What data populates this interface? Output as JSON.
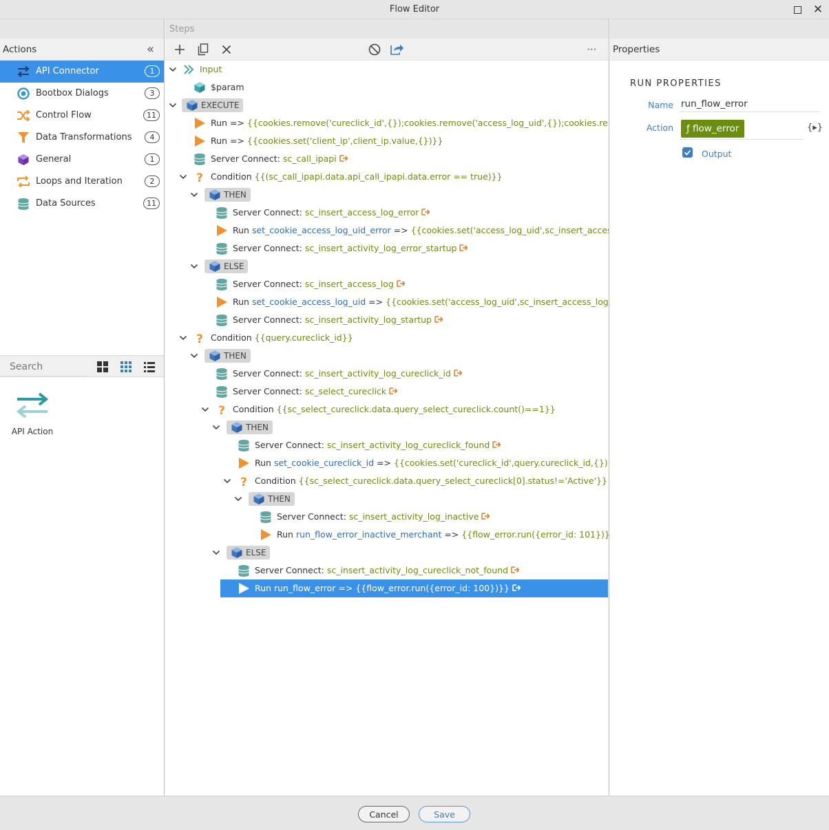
{
  "window": {
    "title": "Flow Editor"
  },
  "actions_panel": {
    "title": "Actions",
    "categories": [
      {
        "label": "API Connector",
        "count": "1",
        "icon": "api-arrows-icon"
      },
      {
        "label": "Bootbox Dialogs",
        "count": "3",
        "icon": "bootbox-icon"
      },
      {
        "label": "Control Flow",
        "count": "11",
        "icon": "shuffle-icon"
      },
      {
        "label": "Data Transformations",
        "count": "4",
        "icon": "funnel-icon"
      },
      {
        "label": "General",
        "count": "1",
        "icon": "cube-icon"
      },
      {
        "label": "Loops and Iteration",
        "count": "2",
        "icon": "loop-icon"
      },
      {
        "label": "Data Sources",
        "count": "11",
        "icon": "database-icon"
      }
    ],
    "search_placeholder": "Search",
    "palette": [
      {
        "label": "API Action",
        "icon": "api-action-icon"
      }
    ]
  },
  "steps_panel": {
    "title": "Steps",
    "rows": [
      {
        "kw": "Input"
      },
      {
        "kw": "$param"
      },
      {
        "kw": "EXECUTE"
      },
      {
        "kw": "Run",
        "op": " => ",
        "ex": "{{cookies.remove('cureclick_id',{});cookies.remove('access_log_uid',{});cookies.remove('client_ip',{})}}"
      },
      {
        "kw": "Run",
        "op": " => ",
        "ex": "{{cookies.set('client_ip',client_ip.value,{})}}"
      },
      {
        "kw": "Server Connect: ",
        "nm": "sc_call_ipapi"
      },
      {
        "kw": "Condition ",
        "ex": "{{(sc_call_ipapi.data.api_call_ipapi.data.error == true)}}"
      },
      {
        "kw": "THEN"
      },
      {
        "kw": "Server Connect: ",
        "nm": "sc_insert_access_log_error"
      },
      {
        "kw": "Run ",
        "nm": "set_cookie_access_log_uid_error",
        "op": " => ",
        "ex": "{{cookies.set('access_log_uid',sc_insert_access_log_error.data.insert_access_log.identity,{})}}"
      },
      {
        "kw": "Server Connect: ",
        "nm": "sc_insert_activity_log_error_startup"
      },
      {
        "kw": "ELSE"
      },
      {
        "kw": "Server Connect: ",
        "nm": "sc_insert_access_log"
      },
      {
        "kw": "Run ",
        "nm": "set_cookie_access_log_uid",
        "op": " => ",
        "ex": "{{cookies.set('access_log_uid',sc_insert_access_log.data.insert_access_log.identity,{})}}"
      },
      {
        "kw": "Server Connect: ",
        "nm": "sc_insert_activity_log_startup"
      },
      {
        "kw": "Condition ",
        "ex": "{{query.cureclick_id}}"
      },
      {
        "kw": "THEN"
      },
      {
        "kw": "Server Connect: ",
        "nm": "sc_insert_activity_log_cureclick_id"
      },
      {
        "kw": "Server Connect: ",
        "nm": "sc_select_cureclick"
      },
      {
        "kw": "Condition ",
        "ex": "{{sc_select_cureclick.data.query_select_cureclick.count()==1}}"
      },
      {
        "kw": "THEN"
      },
      {
        "kw": "Server Connect: ",
        "nm": "sc_insert_activity_log_cureclick_found"
      },
      {
        "kw": "Run ",
        "nm": "set_cookie_cureclick_id",
        "op": " => ",
        "ex": "{{cookies.set('cureclick_id',query.cureclick_id,{})}}"
      },
      {
        "kw": "Condition ",
        "ex": "{{sc_select_cureclick.data.query_select_cureclick[0].status!='Active'}}"
      },
      {
        "kw": "THEN"
      },
      {
        "kw": "Server Connect: ",
        "nm": "sc_insert_activity_log_inactive"
      },
      {
        "kw": "Run ",
        "nm": "run_flow_error_inactive_merchant",
        "op": " => ",
        "ex": "{{flow_error.run({error_id: 101})}}"
      },
      {
        "kw": "ELSE"
      },
      {
        "kw": "Server Connect: ",
        "nm": "sc_insert_activity_log_cureclick_not_found"
      },
      {
        "kw": "Run ",
        "nm": "run_flow_error",
        "op": " => ",
        "ex": "{{flow_error.run({error_id: 100})}}"
      }
    ]
  },
  "properties_panel": {
    "title": "Properties",
    "section_title": "RUN PROPERTIES",
    "name_label": "Name",
    "name_value": "run_flow_error",
    "action_label": "Action",
    "action_value": "ƒ flow_error",
    "data_picker": "{▸}",
    "output_label": "Output"
  },
  "footer": {
    "cancel_label": "Cancel",
    "save_label": "Save"
  },
  "colors": {
    "accent": "#3a92e8",
    "expression": "#6e8b12",
    "name": "#2f6db5",
    "run_orange": "#f0922e",
    "db_teal": "#5fa7a2"
  }
}
